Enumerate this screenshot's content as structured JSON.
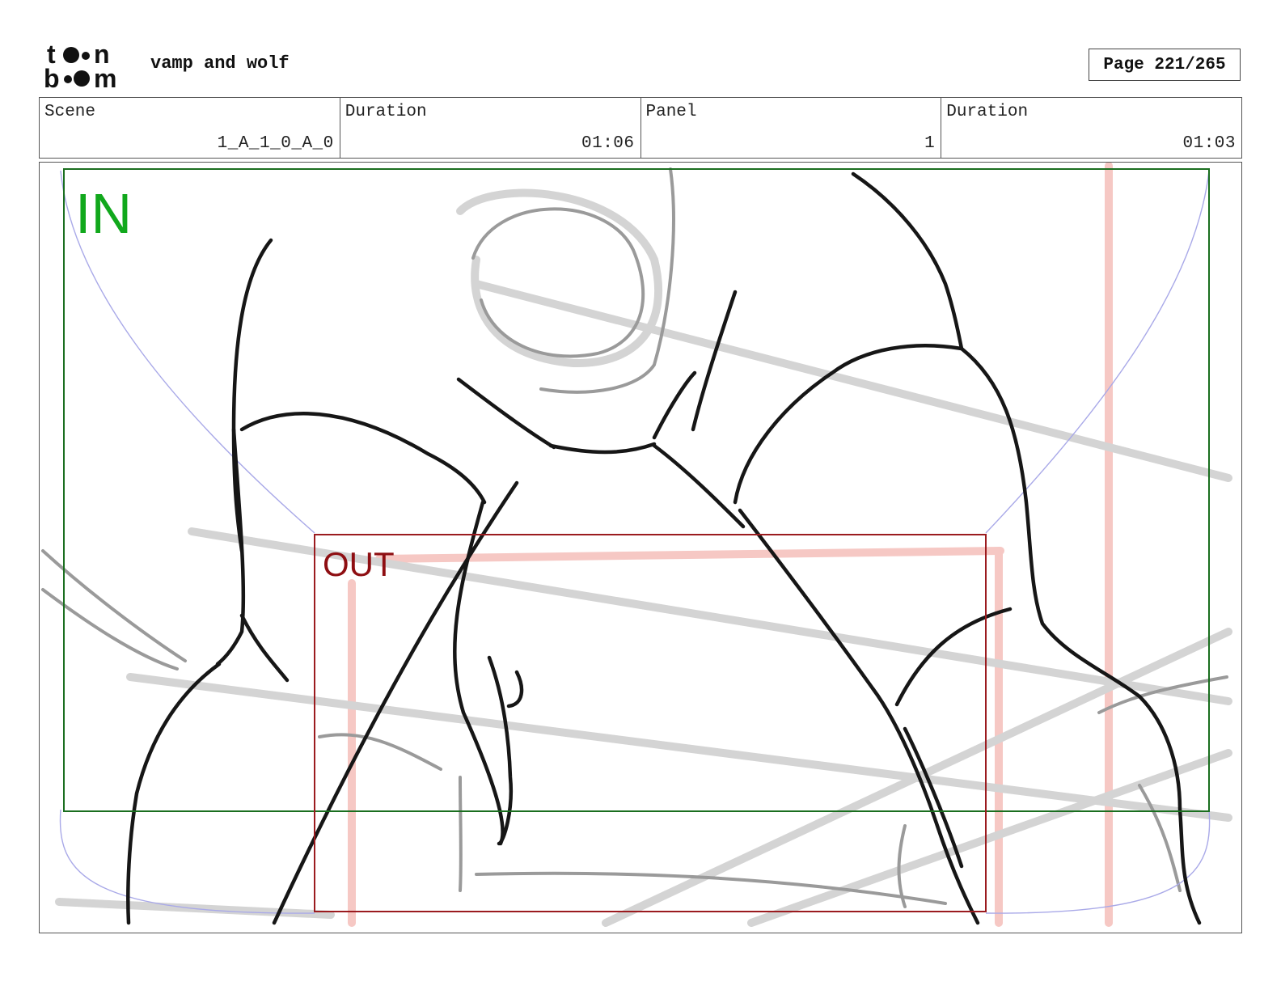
{
  "header": {
    "logo_text": "toon boom",
    "project_title": "vamp and wolf",
    "page_label": "Page 221/265"
  },
  "info": {
    "scene_label": "Scene",
    "scene_value": "1_A_1_0_A_0",
    "scene_duration_label": "Duration",
    "scene_duration_value": "01:06",
    "panel_label": "Panel",
    "panel_value": "1",
    "panel_duration_label": "Duration",
    "panel_duration_value": "01:03"
  },
  "camera": {
    "in_label": "IN",
    "out_label": "OUT",
    "in_color": "#1a6e1f",
    "out_color": "#9b1b1f",
    "guide_color": "#9a9ae0"
  }
}
